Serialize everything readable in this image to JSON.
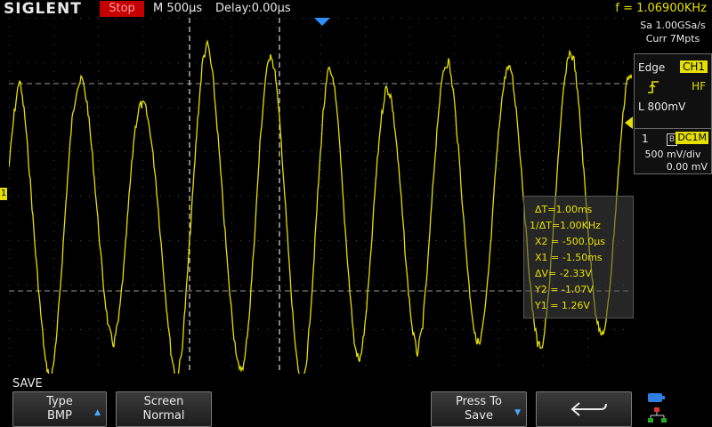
{
  "topbar": {
    "brand": "SIGLENT",
    "run_state": "Stop",
    "timebase": "M 500µs",
    "delay": "Delay:0.00µs",
    "frequency": "f = 1.06900KHz"
  },
  "acquisition": {
    "sample_rate": "Sa 1.00GSa/s",
    "memory_depth": "Curr 7Mpts"
  },
  "trigger": {
    "mode": "Edge",
    "source": "CH1",
    "slope_icon": "rising-edge-icon",
    "coupling": "HF",
    "level": "L  800mV"
  },
  "channel": {
    "number": "1",
    "bandwidth_icon": "B",
    "coupling": "DC1M",
    "scale": "500 mV/div",
    "offset": "0.00 mV"
  },
  "cursors": {
    "delta_t": "ΔT=1.00ms",
    "inv_delta_t": "1/ΔT=1.00KHz",
    "x2": "X2 = -500.0µs",
    "x1": "X1 = -1.50ms",
    "delta_v": "ΔV= -2.33V",
    "y2": "Y2 = -1.07V",
    "y1": "Y1 = 1.26V"
  },
  "softmenu": {
    "title": "SAVE",
    "type_label": "Type",
    "type_value": "BMP",
    "screen_label": "Screen",
    "screen_value": "Normal",
    "save_label": "Press To",
    "save_value": "Save",
    "back_icon": "return-arrow-icon"
  },
  "colors": {
    "channel1": "#e6e000",
    "stop_badge": "#c40000",
    "trigger_marker": "#2f8fff",
    "softkey_arrow": "#4aa8ff"
  },
  "waveform": {
    "samples": [
      0.3,
      0.9,
      1.3,
      0.9,
      0.2,
      -0.6,
      -1.3,
      -1.9,
      -2.1,
      -1.7,
      -0.9,
      0.0,
      0.8,
      1.2,
      1.3,
      1.0,
      0.4,
      -0.3,
      -1.0,
      -1.5,
      -1.7,
      -1.4,
      -0.8,
      0.0,
      0.7,
      1.0,
      1.0,
      0.7,
      0.2,
      -0.5,
      -1.2,
      -1.8,
      -2.1,
      -1.8,
      -1.0,
      -0.1,
      0.8,
      1.5,
      1.7,
      1.3,
      0.6,
      -0.2,
      -1.0,
      -1.6,
      -2.0,
      -1.9,
      -1.3,
      -0.4,
      0.6,
      1.3,
      1.6,
      1.3,
      0.6,
      -0.3,
      -1.2,
      -1.9,
      -2.2,
      -1.8,
      -1.0,
      0.0,
      0.9,
      1.4,
      1.3,
      0.7,
      -0.2,
      -1.0,
      -1.7,
      -1.9,
      -1.5,
      -0.8,
      0.1,
      0.8,
      1.2,
      1.1,
      0.6,
      -0.1,
      -0.9,
      -1.5,
      -1.8,
      -1.5,
      -0.8,
      0.1,
      0.9,
      1.4,
      1.5,
      1.1,
      0.4,
      -0.4,
      -1.1,
      -1.6,
      -1.7,
      -1.3,
      -0.6,
      0.3,
      1.0,
      1.4,
      1.4,
      0.9,
      0.2,
      -0.6,
      -1.3,
      -1.7,
      -1.7,
      -1.2,
      -0.4,
      0.5,
      1.2,
      1.6,
      1.5,
      0.9,
      0.1,
      -0.7,
      -1.3,
      -1.6,
      -1.5,
      -0.9,
      -0.1,
      0.7,
      1.3,
      1.3
    ]
  }
}
